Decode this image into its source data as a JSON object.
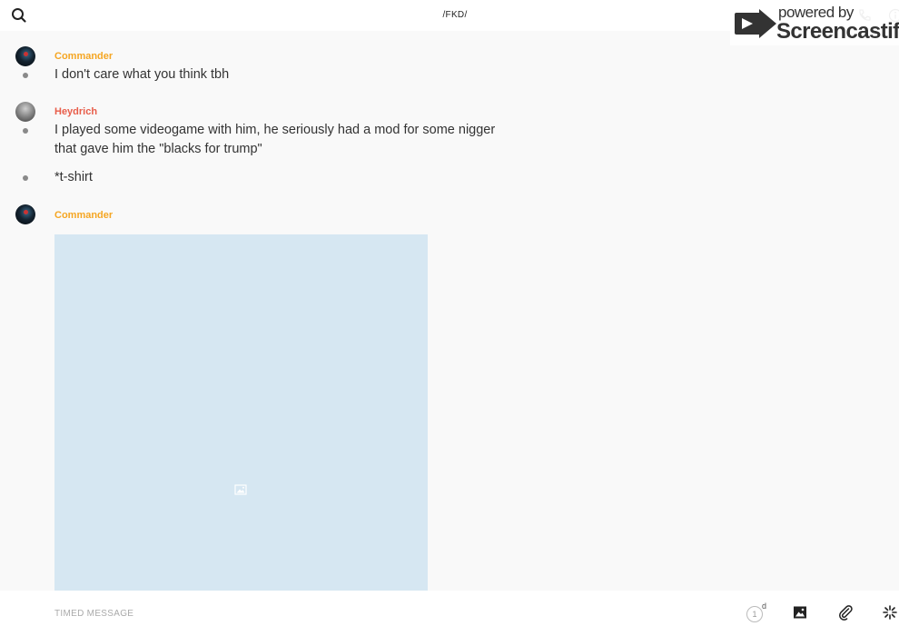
{
  "header": {
    "title": "/FKD/",
    "search_icon": "search-icon",
    "phone_icon": "phone-icon",
    "info_icon": "info-icon"
  },
  "watermark": {
    "powered_by": "powered by",
    "brand": "Screencastify"
  },
  "messages": [
    {
      "sender": "Commander",
      "sender_color": "#f5a623",
      "avatar": "commander-avatar",
      "lines": [
        "I don't care what you think tbh"
      ]
    },
    {
      "sender": "Heydrich",
      "sender_color": "#e85d4a",
      "avatar": "heydrich-avatar",
      "lines": [
        "I played some videogame with him, he seriously had a mod for some nigger",
        "that gave him the \"blacks for trump\""
      ]
    },
    {
      "sender": "",
      "lines": [
        "*t-shirt"
      ]
    },
    {
      "sender": "Commander",
      "sender_color": "#f5a623",
      "avatar": "commander-avatar",
      "attachment": "image",
      "image_bg": "#d6e7f2"
    }
  ],
  "composer": {
    "placeholder": "TIMED MESSAGE",
    "timer_value": "1",
    "timer_unit": "d",
    "photo_icon": "photo-icon",
    "attach_icon": "paperclip-icon",
    "spark_icon": "sparkle-icon"
  }
}
